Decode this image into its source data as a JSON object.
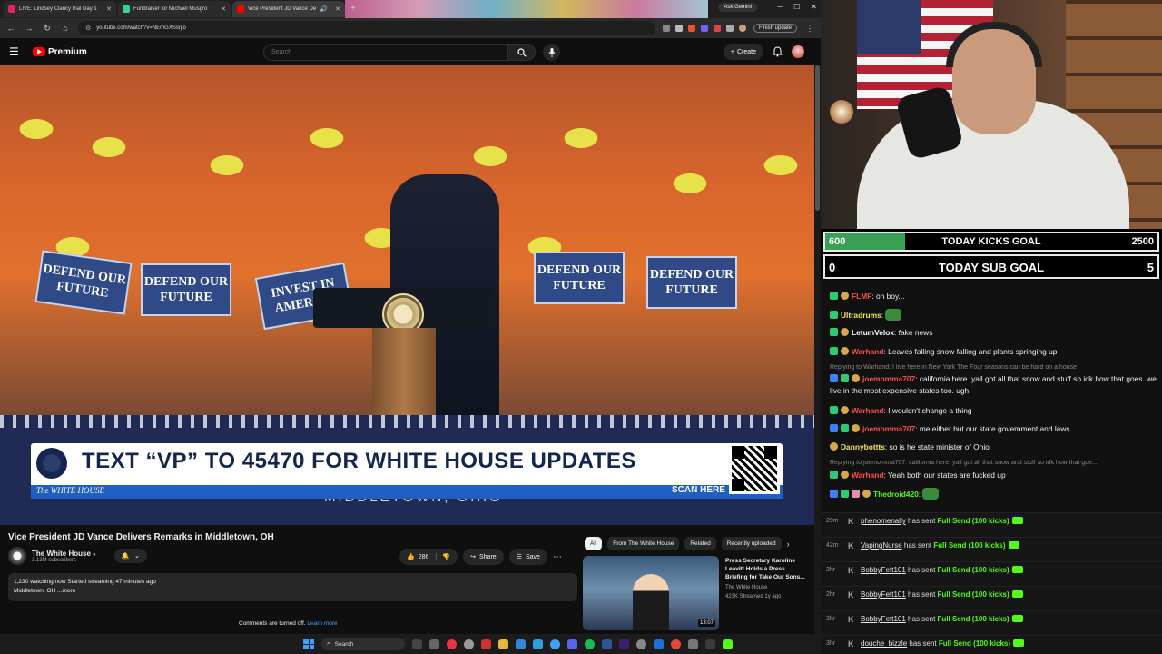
{
  "browser": {
    "tabs": [
      {
        "title": "LIVE: Lindsey Clancy trial Day 1",
        "favicon_color": "#e0245e"
      },
      {
        "title": "Fundraiser for Michael Musgro",
        "favicon_color": "#3ecf8e"
      },
      {
        "title": "Vice President JD Vance De",
        "favicon_color": "#ff0000"
      }
    ],
    "ask_gemini": "Ask Gemini",
    "url": "youtube.com/watch?v=NEmGXSsrjio",
    "finish_update": "Finish update"
  },
  "youtube": {
    "logo_text": "Premium",
    "search_placeholder": "Search",
    "create_label": "Create",
    "video": {
      "lower_third_headline": "TEXT “VP” TO 45470 FOR WHITE HOUSE UPDATES",
      "lower_third_brand": "The WHITE HOUSE",
      "scan_here": "SCAN HERE",
      "location": "MIDDLETOWN, OHIO",
      "sign_text": "DEFEND OUR FUTURE",
      "sign_invest": "INVEST IN AMERICA"
    },
    "title": "Vice President JD Vance Delivers Remarks in Middletown, OH",
    "channel": {
      "name": "The White House",
      "subs": "3.13M subscribers"
    },
    "likes": "286",
    "share_label": "Share",
    "save_label": "Save",
    "description": {
      "line1": "1,230 watching now  Started streaming 47 minutes ago",
      "line2": "Middletown, OH ...more"
    },
    "comments_off": "Comments are turned off.",
    "learn_more": "Learn more",
    "chips": [
      "All",
      "From The White House",
      "Related",
      "Recently uploaded"
    ],
    "recommended": {
      "title": "Press Secretary Karoline Leavitt Holds a Press Briefing for Take Our Sons...",
      "channel": "The White House",
      "meta": "423K  Streamed 1y ago",
      "duration": "13:07"
    }
  },
  "taskbar": {
    "search": "Search"
  },
  "stream": {
    "kicks_goal": {
      "label": "TODAY KICKS GOAL",
      "current": "600",
      "target": "2500",
      "progress": 0.24
    },
    "sub_goal": {
      "label": "TODAY SUB GOAL",
      "current": "0",
      "target": "5",
      "progress": 0.0
    },
    "chat_partial": "...",
    "chat": [
      {
        "user": "FLMF",
        "color": "#ff4d4d",
        "text": ": oh boy..."
      },
      {
        "user": "Ultradrums",
        "color": "#f5e663",
        "text": ":"
      },
      {
        "user": "LetumVelox",
        "color": "#ffffff",
        "text": ": fake news"
      },
      {
        "user": "Warhand",
        "color": "#ff4d4d",
        "text": ": Leaves falling snow falling and plants springing up"
      },
      {
        "reply": "Replying to Warhand: I live here in New York The Four seasons can be hard on a house"
      },
      {
        "user": "joemomma707",
        "color": "#ff4d4d",
        "text": ": california here. yall got all that snow and stuff so idk how that goes. we live in the most expensive states too. ugh"
      },
      {
        "user": "Warhand",
        "color": "#ff4d4d",
        "text": ": I wouldn't change a thing"
      },
      {
        "user": "joemomma707",
        "color": "#ff4d4d",
        "text": ": me either but our state government and laws"
      },
      {
        "user": "Dannybottts",
        "color": "#f5e663",
        "text": ": so is he state minister of Ohio"
      },
      {
        "reply": "Replying to joemomma707: california here. yall got all that snow and stuff so idk how that goe..."
      },
      {
        "user": "Warhand",
        "color": "#ff4d4d",
        "text": ": Yeah both our states are fucked up"
      },
      {
        "user": "Thedroid420",
        "color": "#53fc18",
        "text": ":"
      }
    ],
    "events": [
      {
        "time": "29m",
        "user": "phenomenally",
        "mid": "has sent",
        "gift": "Full Send (100 kicks)"
      },
      {
        "time": "42m",
        "user": "VapingNurse",
        "mid": "has sent",
        "gift": "Full Send (100 kicks)"
      },
      {
        "time": "2hr",
        "user": "BobbyFett101",
        "mid": "has sent",
        "gift": "Full Send (100 kicks)"
      },
      {
        "time": "2hr",
        "user": "BobbyFett101",
        "mid": "has sent",
        "gift": "Full Send (100 kicks)"
      },
      {
        "time": "2hr",
        "user": "BobbyFett101",
        "mid": "has sent",
        "gift": "Full Send (100 kicks)"
      },
      {
        "time": "3hr",
        "user": "douche_bizzle",
        "mid": "has sent",
        "gift": "Full Send (100 kicks)"
      }
    ]
  }
}
